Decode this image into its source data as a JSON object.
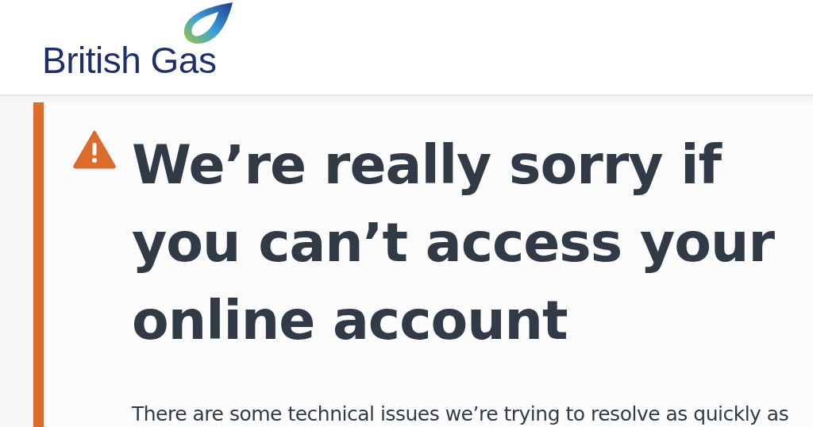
{
  "header": {
    "logo_text": "British Gas"
  },
  "alert": {
    "title": "We’re really sorry if you can’t access your online account",
    "message": "There are some technical issues we’re trying to resolve as quickly as"
  }
}
